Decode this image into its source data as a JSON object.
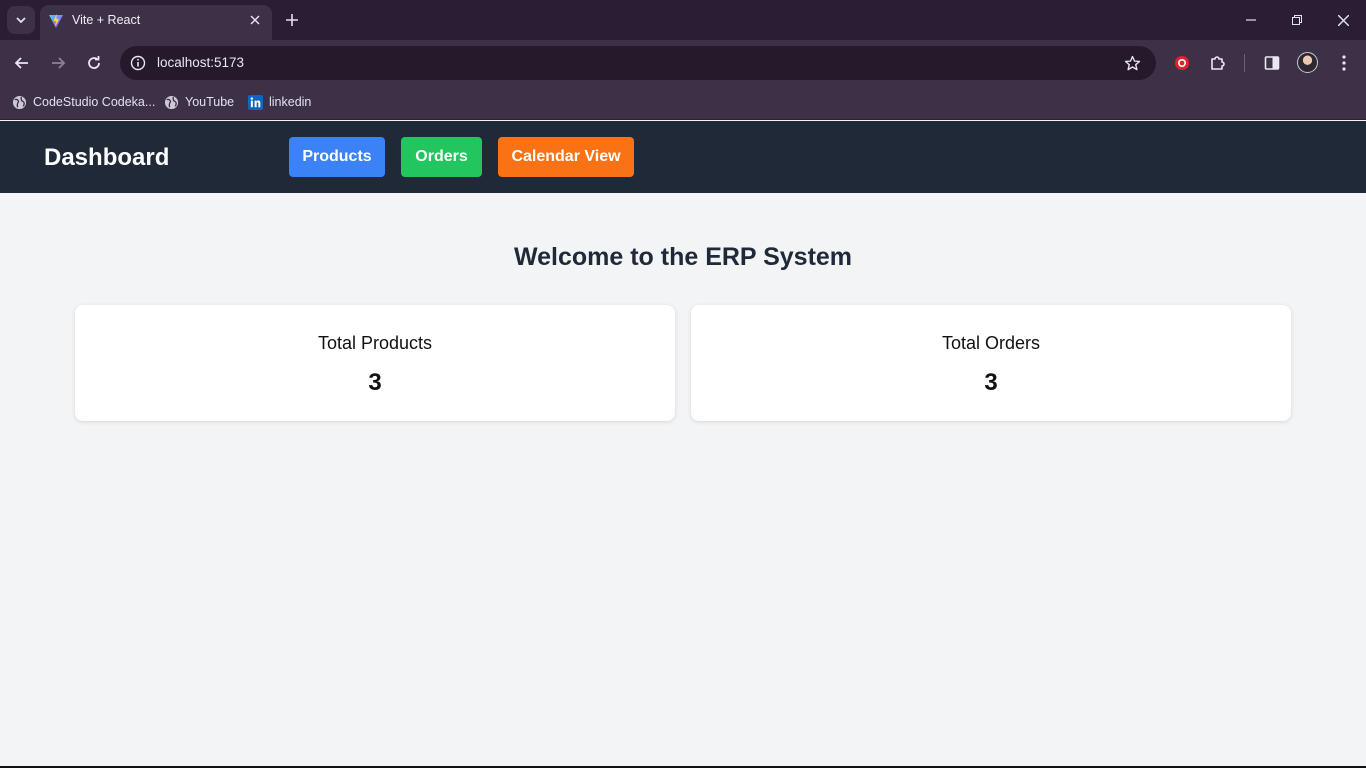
{
  "browser": {
    "tab_title": "Vite + React",
    "url": "localhost:5173",
    "bookmarks": [
      {
        "label": "CodeStudio Codeka...",
        "icon": "globe-icon"
      },
      {
        "label": "YouTube",
        "icon": "globe-icon"
      },
      {
        "label": "linkedin",
        "icon": "linkedin-icon"
      }
    ]
  },
  "app": {
    "brand": "Dashboard",
    "nav": [
      {
        "label": "Products",
        "color": "#3b82f6"
      },
      {
        "label": "Orders",
        "color": "#22c55e"
      },
      {
        "label": "Calendar View",
        "color": "#f97316"
      }
    ],
    "nav_bg": "#1f2937",
    "title": "Welcome to the ERP System",
    "stats": [
      {
        "label": "Total Products",
        "value": "3"
      },
      {
        "label": "Total Orders",
        "value": "3"
      }
    ]
  }
}
